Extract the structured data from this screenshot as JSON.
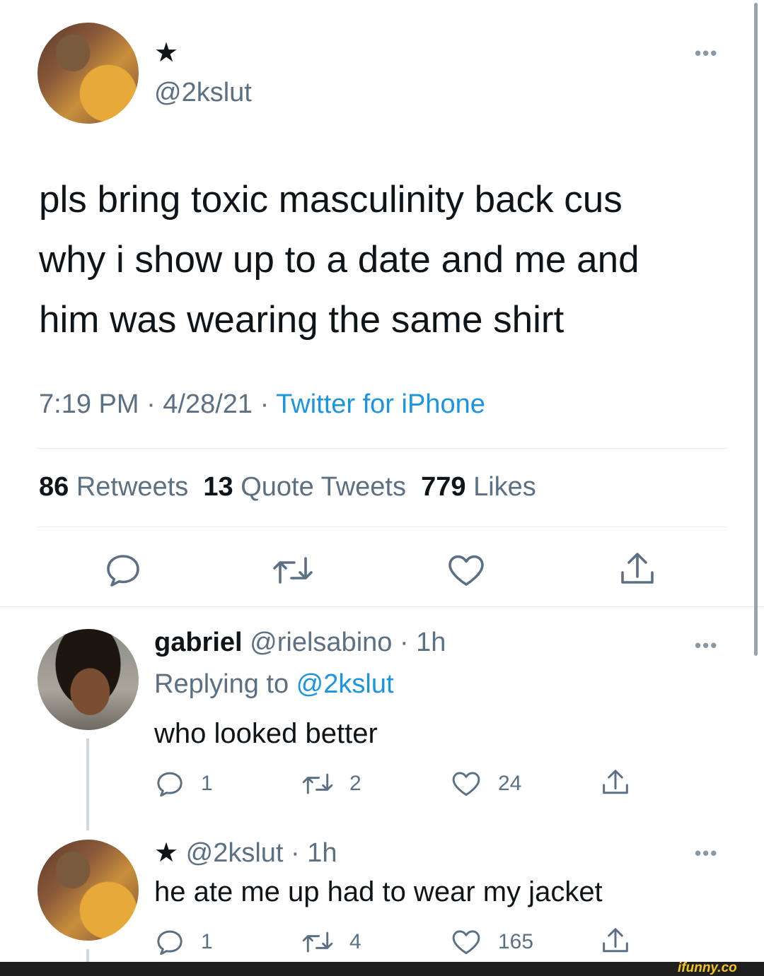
{
  "main_tweet": {
    "name_star": "★",
    "handle": "@2kslut",
    "text_lines": [
      "pls bring toxic masculinity back cus",
      "why i show up to a date and me and",
      "him was wearing the same shirt"
    ],
    "time": "7:19 PM · 4/28/21 · ",
    "source": "Twitter for iPhone",
    "retweets_count": "86",
    "retweets_label": "Retweets",
    "quotes_count": "13",
    "quotes_label": "Quote Tweets",
    "likes_count": "779",
    "likes_label": "Likes"
  },
  "replies": [
    {
      "name": "gabriel",
      "handle_time": "@rielsabino · 1h",
      "replying_prefix": "Replying to ",
      "replying_handle": "@2kslut",
      "text": "who looked better",
      "reply_count": "1",
      "retweet_count": "2",
      "like_count": "24"
    },
    {
      "name_star": "★",
      "handle_time": "@2kslut · 1h",
      "text": "he ate me up had to wear my jacket",
      "reply_count": "1",
      "retweet_count": "4",
      "like_count": "165"
    }
  ],
  "more_menu": "•••",
  "watermark": "ifunny.co",
  "icons": [
    "reply-icon",
    "retweet-icon",
    "like-icon",
    "share-icon",
    "more-icon"
  ],
  "colors": {
    "link": "#1b95e0",
    "secondary": "#5b7083",
    "divider": "#e6ecf0"
  }
}
